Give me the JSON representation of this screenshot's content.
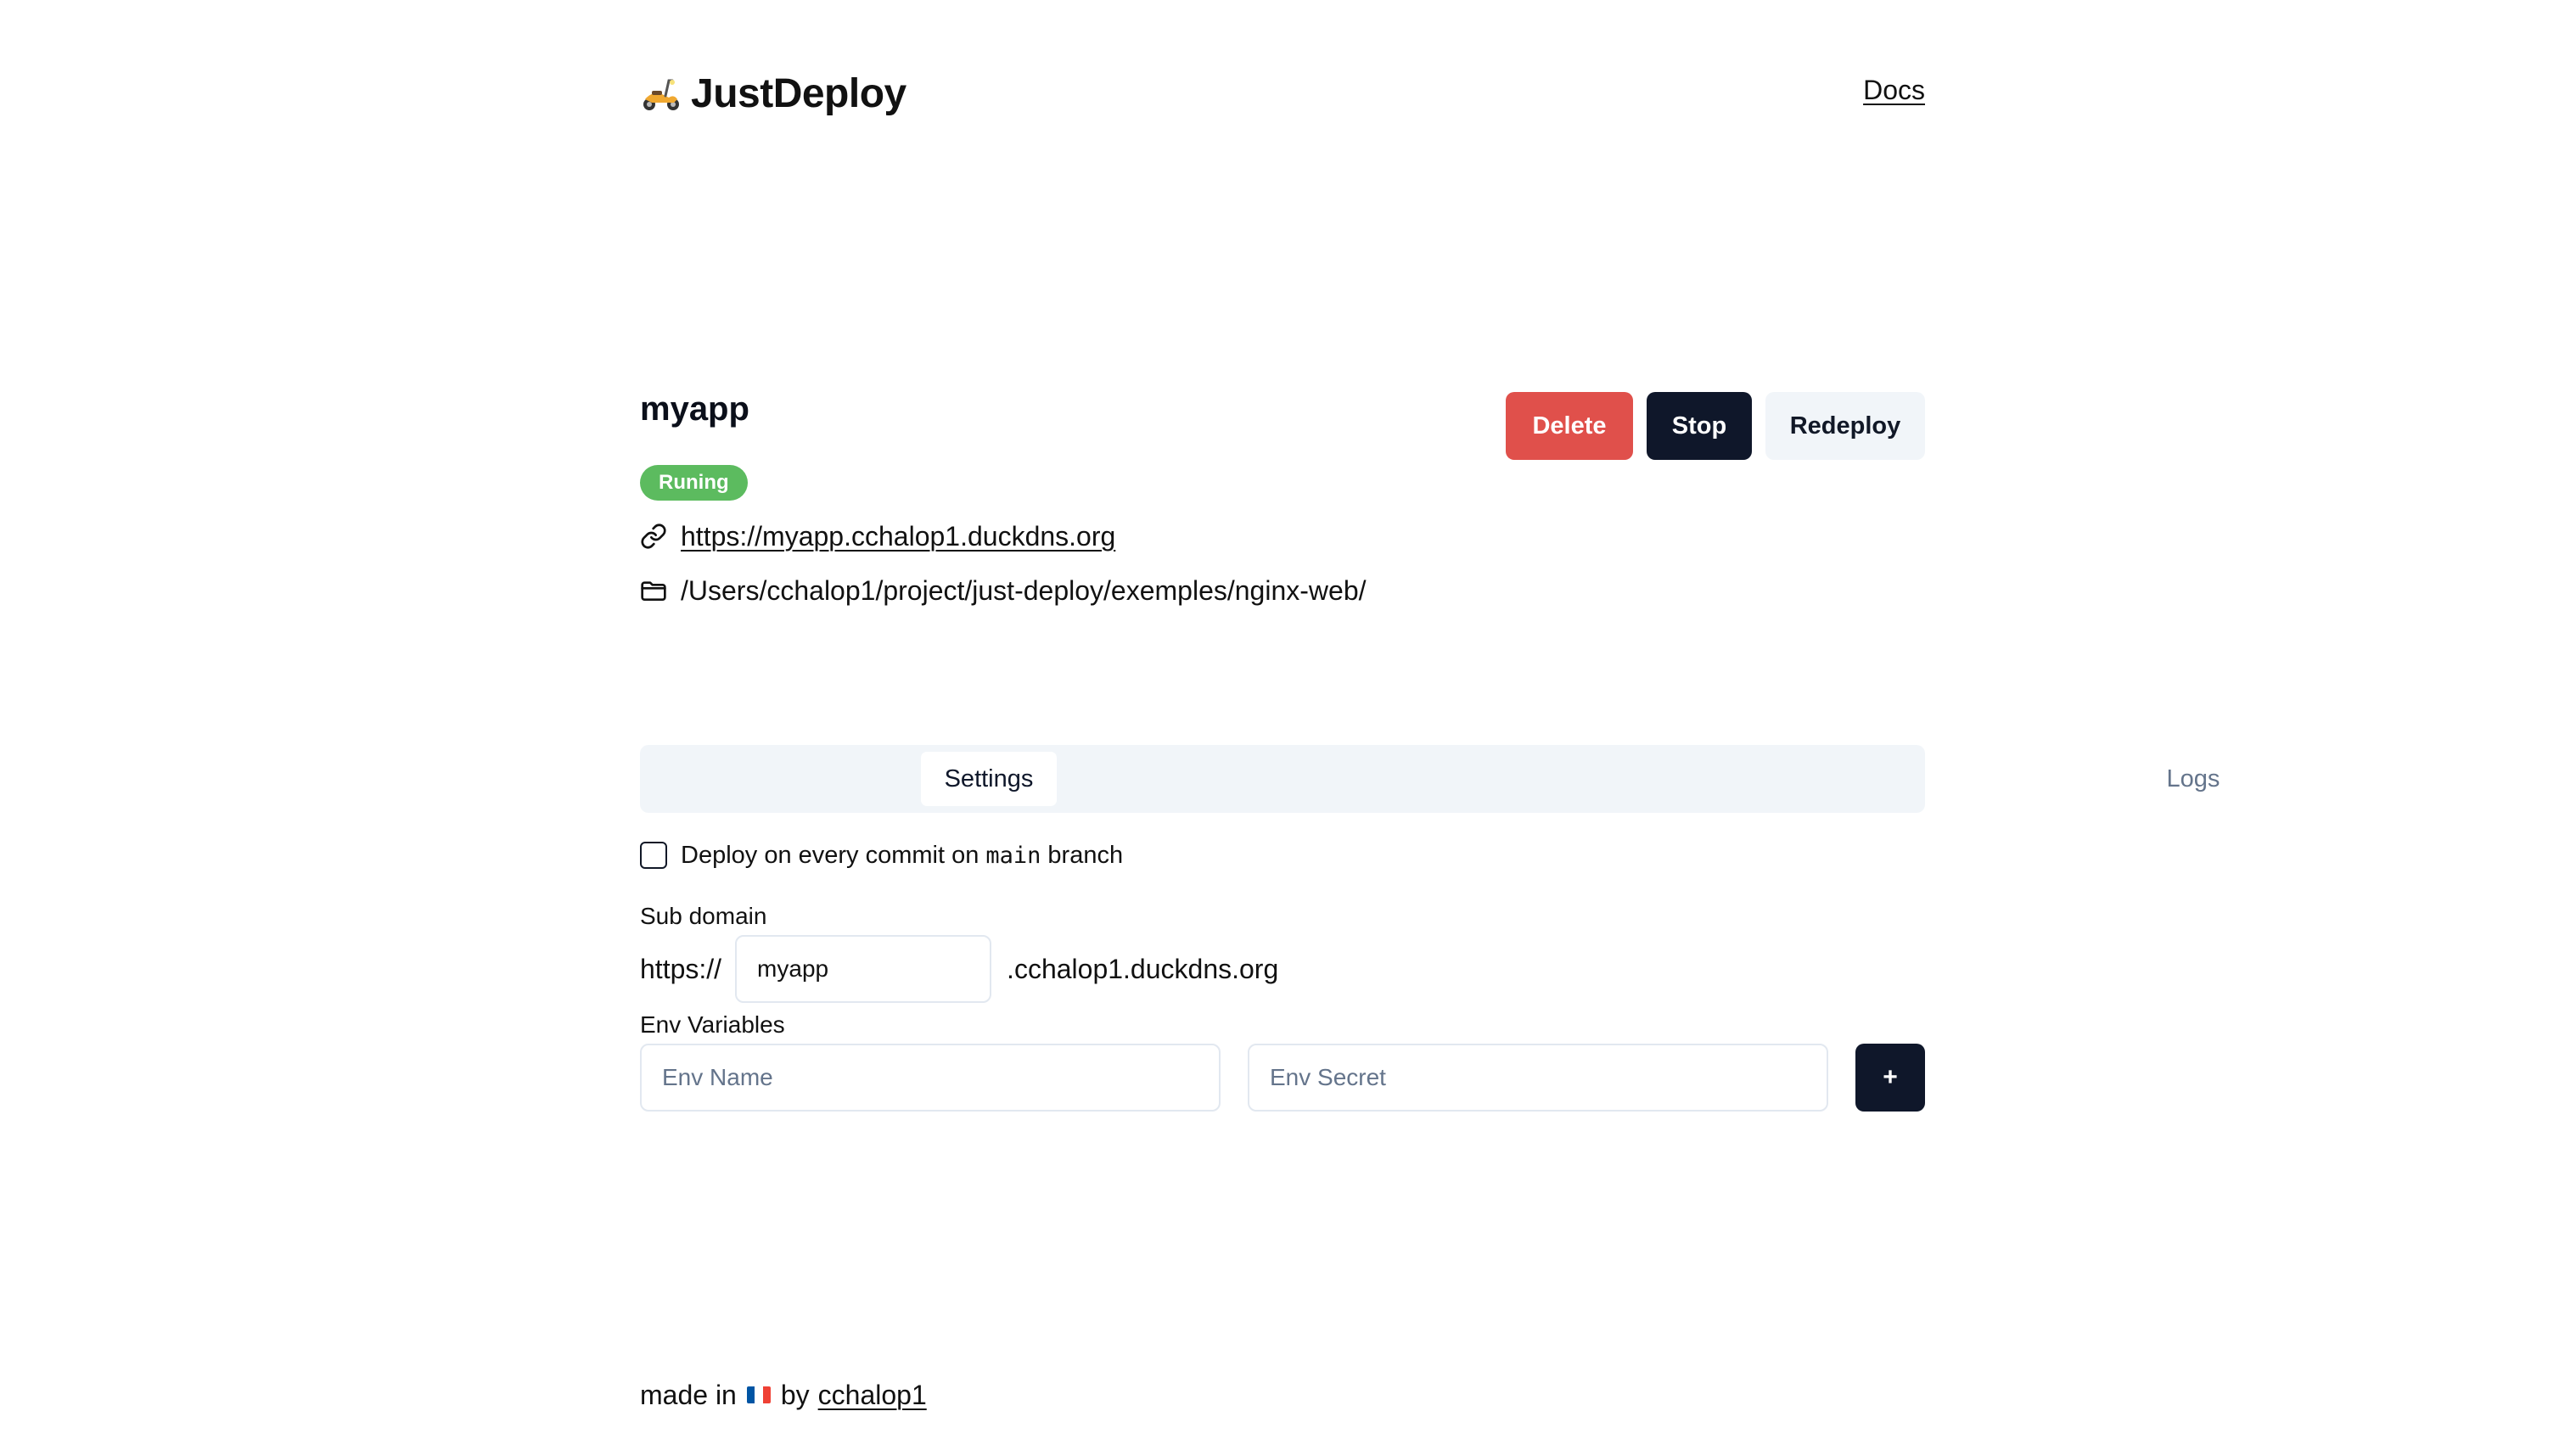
{
  "header": {
    "brand": "JustDeploy",
    "brand_icon": "scooter-icon",
    "docs_label": "Docs"
  },
  "app": {
    "name": "myapp",
    "status": "Runing",
    "url": "https://myapp.cchalop1.duckdns.org",
    "path": "/Users/cchalop1/project/just-deploy/exemples/nginx-web/"
  },
  "actions": {
    "delete_label": "Delete",
    "stop_label": "Stop",
    "redeploy_label": "Redeploy"
  },
  "tabs": [
    {
      "label": "Settings",
      "active": true
    },
    {
      "label": "Logs",
      "active": false
    }
  ],
  "settings": {
    "auto_deploy": {
      "checked": false,
      "prefix": "Deploy on every commit on",
      "branch": "main",
      "suffix": "branch"
    },
    "subdomain": {
      "label": "Sub domain",
      "scheme": "https://",
      "value": "myapp",
      "suffix": ".cchalop1.duckdns.org"
    },
    "env": {
      "label": "Env Variables",
      "name_placeholder": "Env Name",
      "secret_placeholder": "Env Secret",
      "add_label": "+"
    }
  },
  "footer": {
    "prefix": "made in",
    "by": "by",
    "author": "cchalop1",
    "flag_icon": "france-flag-icon"
  },
  "colors": {
    "danger": "#e0504b",
    "primary": "#0f172a",
    "secondary": "#f1f5f9",
    "status_running": "#5cbb5f",
    "muted": "#64748b"
  }
}
